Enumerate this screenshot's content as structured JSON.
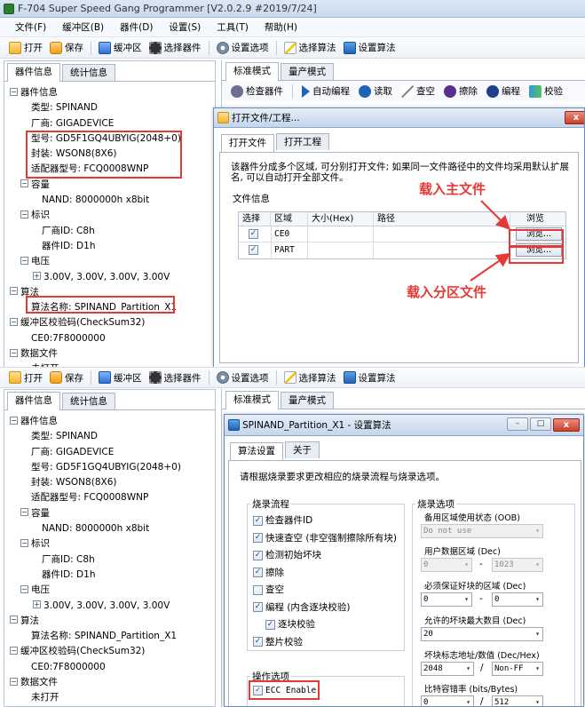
{
  "window": {
    "title": "F-704 Super Speed Gang Programmer  [V2.0.2.9 #2019/7/24]"
  },
  "menu": [
    "文件(F)",
    "缓冲区(B)",
    "器件(D)",
    "设置(S)",
    "工具(T)",
    "帮助(H)"
  ],
  "toolbar": {
    "open": "打开",
    "save": "保存",
    "buffer": "缓冲区",
    "select_device": "选择器件",
    "settings": "设置选项",
    "select_algo": "选择算法",
    "set_algo": "设置算法"
  },
  "left_tabs": {
    "device_info": "器件信息",
    "stats": "统计信息"
  },
  "tree": {
    "device_info": "器件信息",
    "type": "类型: SPINAND",
    "vendor": "厂商: GIGADEVICE",
    "model": "型号: GD5F1GQ4UBYIG(2048+0)",
    "package": "封装: WSON8(8X6)",
    "adapter": "适配器型号: FCQ0008WNP",
    "capacity": "容量",
    "nand": "NAND: 8000000h x8bit",
    "id_label": "标识",
    "vendor_id": "厂商ID: C8h",
    "device_id": "器件ID: D1h",
    "voltage": "电压",
    "voltage_values": "3.00V, 3.00V, 3.00V, 3.00V",
    "algorithm": "算法",
    "algo_name": "算法名称: SPINAND_Partition_X1",
    "checksum": "缓冲区校验码(CheckSum32)",
    "checksum_value": "CE0:7F8000000",
    "data_file": "数据文件",
    "not_open": "未打开"
  },
  "right_tabs": {
    "standard": "标准模式",
    "mass": "量产模式"
  },
  "actions": {
    "check_device": "检查器件",
    "auto_program": "自动编程",
    "read": "读取",
    "blank_check": "查空",
    "erase": "擦除",
    "program": "编程",
    "verify": "校验"
  },
  "open_dialog": {
    "title": "打开文件/工程...",
    "close": "x",
    "tab_file": "打开文件",
    "tab_project": "打开工程",
    "desc": "该器件分成多个区域, 可分别打开文件; 如果同一文件路径中的文件均采用默认扩展名, 可以自动打开全部文件。",
    "group": "文件信息",
    "columns": [
      "选择",
      "区域",
      "大小(Hex)",
      "路径",
      "浏览"
    ],
    "rows": [
      {
        "check": "✓",
        "region": "CE0",
        "size": "",
        "path": "",
        "browse": "浏览..."
      },
      {
        "check": "✓",
        "region": "PART",
        "size": "",
        "path": "",
        "browse": "浏览..."
      }
    ]
  },
  "annotations": {
    "main_file": "载入主文件",
    "partition_file": "载入分区文件"
  },
  "algo_dialog": {
    "title": "SPINAND_Partition_X1 - 设置算法",
    "min": "–",
    "max": "□",
    "close": "x",
    "tab_settings": "算法设置",
    "tab_about": "关于",
    "desc": "请根据烧录要求更改相应的烧录流程与烧录选项。",
    "flow_label": "烧录流程",
    "flow": [
      {
        "check": "✓",
        "label": "检查器件ID"
      },
      {
        "check": "✓",
        "label": "快速查空 (非空强制擦除所有块)"
      },
      {
        "check": "✓",
        "label": "检测初始坏块"
      },
      {
        "check": "✓",
        "label": "擦除"
      },
      {
        "check": "",
        "label": "查空"
      },
      {
        "check": "✓",
        "label": "编程 (内含逐块校验)"
      },
      {
        "check": "✓",
        "label": "逐块校验"
      },
      {
        "check": "✓",
        "label": "整片校验"
      }
    ],
    "ops_label": "操作选项",
    "ecc": {
      "check": "✓",
      "label": "ECC Enable"
    },
    "opt_label": "烧录选项",
    "backup": "备用区域使用状态 (OOB)",
    "backup_value": "Do not use",
    "user_area": "用户数据区域 (Dec)",
    "user_from": "0",
    "user_to": "1023",
    "guarantee": "必须保证好块的区域 (Dec)",
    "g_from": "0",
    "g_to": "0",
    "max_bad": "允许的坏块最大数目 (Dec)",
    "max_bad_value": "20",
    "badmark": "坏块标志地址/数值 (Dec/Hex)",
    "bm_addr": "2048",
    "bm_val": "Non-FF",
    "bitrate": "比特容错率 (bits/Bytes)",
    "br_a": "0",
    "br_b": "512",
    "dash": "-",
    "slash": "/"
  },
  "glyphs": {
    "expand": "−",
    "collapse": "+",
    "arrow": "▾"
  },
  "colors": {
    "highlight": "#e53935",
    "accent": "#1e64b8"
  }
}
